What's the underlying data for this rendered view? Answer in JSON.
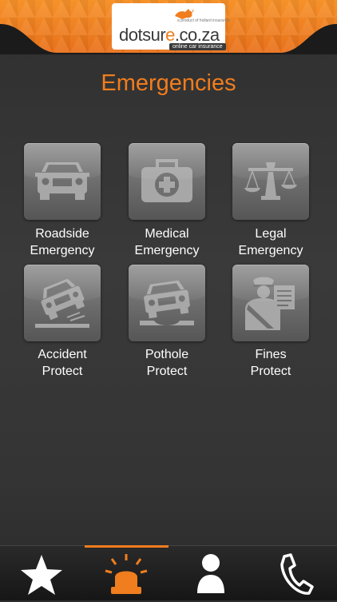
{
  "header": {
    "logo_main": "dotsur",
    "logo_accent": "e",
    "logo_domain": ".co.za",
    "logo_tagline": "online car insurance",
    "logo_small": "a product of hollard insurance"
  },
  "page": {
    "title": "Emergencies"
  },
  "tiles": [
    {
      "icon": "car-icon",
      "line1": "Roadside",
      "line2": "Emergency"
    },
    {
      "icon": "first-aid-kit-icon",
      "line1": "Medical",
      "line2": "Emergency"
    },
    {
      "icon": "scales-icon",
      "line1": "Legal",
      "line2": "Emergency"
    },
    {
      "icon": "car-crash-icon",
      "line1": "Accident",
      "line2": "Protect"
    },
    {
      "icon": "car-pothole-icon",
      "line1": "Pothole",
      "line2": "Protect"
    },
    {
      "icon": "traffic-officer-icon",
      "line1": "Fines",
      "line2": "Protect"
    }
  ],
  "tabbar": {
    "tabs": [
      {
        "icon": "star-icon",
        "active": false
      },
      {
        "icon": "alarm-light-icon",
        "active": true
      },
      {
        "icon": "person-icon",
        "active": false
      },
      {
        "icon": "phone-icon",
        "active": false
      }
    ]
  },
  "colors": {
    "accent": "#f07d1e",
    "background": "#333333",
    "text": "#ffffff"
  }
}
